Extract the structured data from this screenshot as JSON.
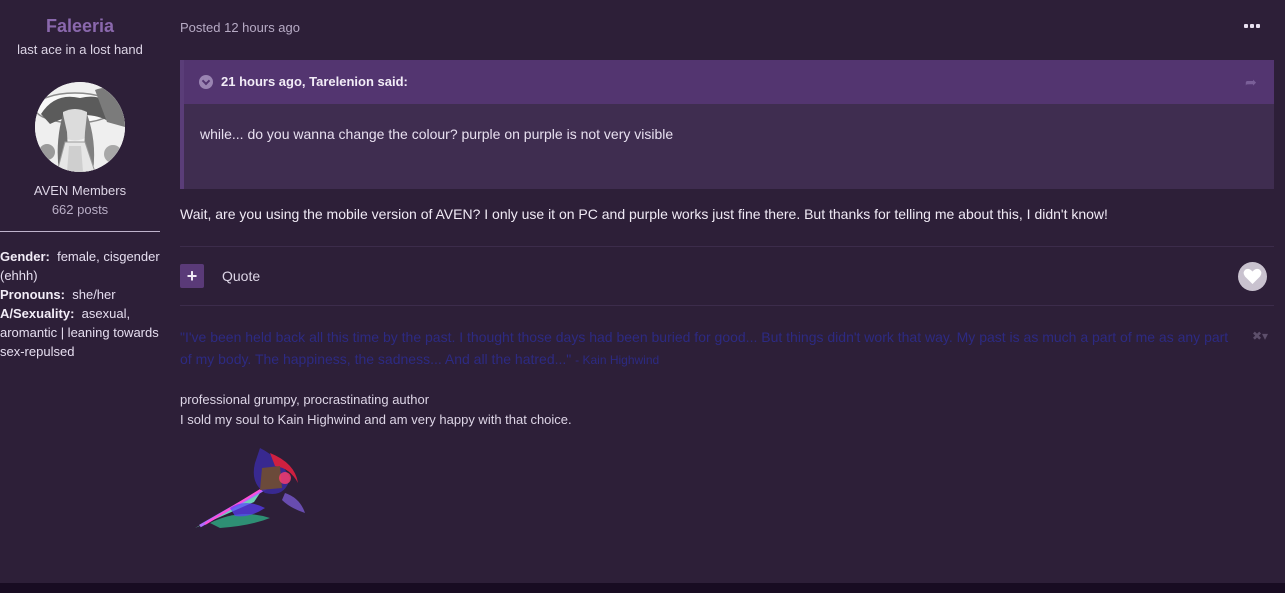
{
  "author": {
    "name": "Faleeria",
    "title": "last ace in a lost hand",
    "group": "AVEN Members",
    "posts": "662 posts",
    "fields": [
      {
        "label": "Gender:",
        "value": "female, cisgender (ehhh)"
      },
      {
        "label": "Pronouns:",
        "value": "she/her"
      },
      {
        "label": "A/Sexuality:",
        "value": "asexual, aromantic | leaning towards sex-repulsed"
      }
    ]
  },
  "post": {
    "posted_prefix": "Posted",
    "posted_time": "12 hours ago",
    "more_icon": "ellipsis-icon",
    "quote": {
      "cite": "21 hours ago, Tarelenion said:",
      "body": "while... do you wanna change the colour? purple on purple is not very visible"
    },
    "content": "Wait, are you using the mobile version of AVEN? I only use it on PC and purple works just fine there. But thanks for telling me about this, I didn't know!",
    "actions": {
      "multiquote_label": "+",
      "quote_label": "Quote"
    }
  },
  "signature": {
    "quote": "\"I've been held back all this time by the past. I thought those days had been buried for good... But things didn't work that way. My past is as much a part of me as any part of my body. The happiness, the sadness... And all the hatred...\"",
    "attribution": "- Kain Highwind",
    "line1": "professional grumpy, procrastinating author",
    "line2": "I sold my soul to Kain Highwind and am very happy with that choice."
  },
  "colors": {
    "background": "#2d1f38",
    "accent": "#8a68ad",
    "quote_header": "#533570",
    "signature_text": "#2d2a82"
  }
}
